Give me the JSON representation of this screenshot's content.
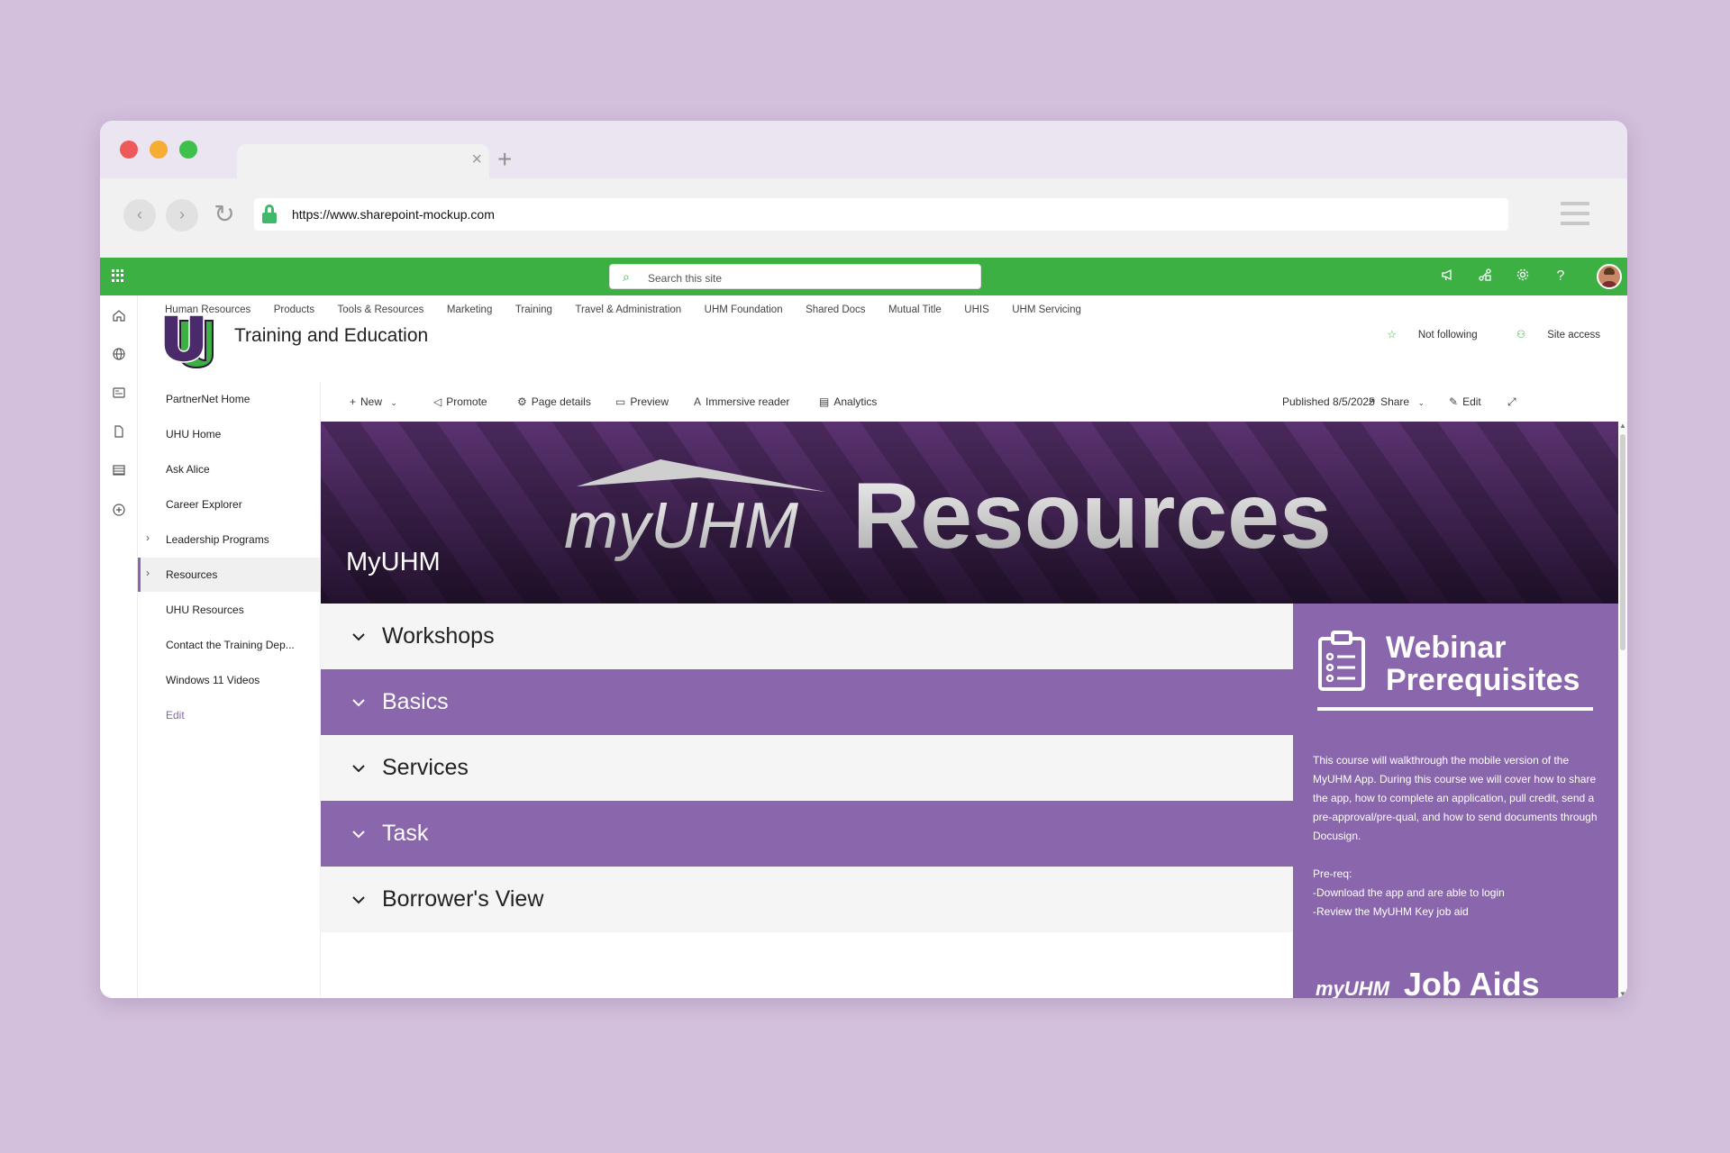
{
  "browser": {
    "url": "https://www.sharepoint-mockup.com",
    "tab_close": "×",
    "new_tab": "+"
  },
  "suitebar": {
    "search_placeholder": "Search this site",
    "icons": [
      "megaphone-icon",
      "share-icon",
      "gear-icon",
      "help-icon"
    ],
    "accent": "#3cb043"
  },
  "topnav": [
    "Human Resources",
    "Products",
    "Tools & Resources",
    "Marketing",
    "Training",
    "Travel & Administration",
    "UHM Foundation",
    "Shared Docs",
    "Mutual Title",
    "UHIS",
    "UHM Servicing"
  ],
  "site": {
    "title": "Training and Education",
    "not_following": "Not following",
    "site_access": "Site access"
  },
  "quicknav": {
    "items": [
      {
        "label": "PartnerNet Home"
      },
      {
        "label": "UHU Home"
      },
      {
        "label": "Ask Alice"
      },
      {
        "label": "Career Explorer"
      },
      {
        "label": "Leadership Programs"
      },
      {
        "label": "Resources"
      },
      {
        "label": "UHU Resources"
      },
      {
        "label": "Contact the Training Dep..."
      },
      {
        "label": "Windows 11 Videos"
      }
    ],
    "edit": "Edit"
  },
  "commandbar": {
    "new": "New",
    "promote": "Promote",
    "page_details": "Page details",
    "preview": "Preview",
    "immersive_reader": "Immersive reader",
    "analytics": "Analytics",
    "published": "Published 8/5/2025",
    "share": "Share",
    "edit": "Edit"
  },
  "banner": {
    "title": "MyUHM",
    "logo_text": "myUHM",
    "headline": "Resources",
    "color": "#3a1f4a"
  },
  "accordion": [
    {
      "label": "Workshops"
    },
    {
      "label": "Basics"
    },
    {
      "label": "Services"
    },
    {
      "label": "Task"
    },
    {
      "label": "Borrower's View"
    }
  ],
  "sidecard": {
    "heading_line1": "Webinar",
    "heading_line2": "Prerequisites",
    "description": "This course will walkthrough the mobile version of the MyUHM App. During this course we will cover how to share the app, how to complete an application, pull credit, send a pre-approval/pre-qual, and how to send documents through Docusign.",
    "prereq_title": "Pre-req:",
    "prereq_1": "-Download the app and are able to login",
    "prereq_2": "-Review the MyUHM Key job aid",
    "footer_logo": "myUHM",
    "footer_text": "Job Aids",
    "color": "#8a66ad"
  }
}
